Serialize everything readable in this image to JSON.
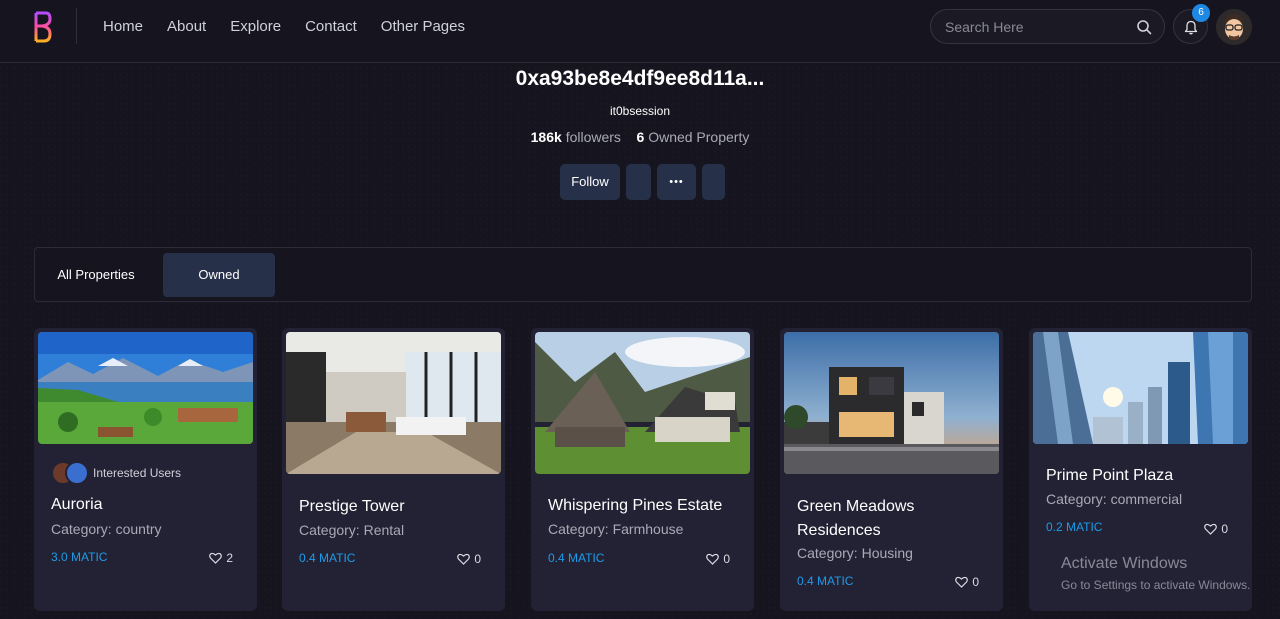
{
  "nav": {
    "links": [
      "Home",
      "About",
      "Explore",
      "Contact",
      "Other Pages"
    ],
    "search_placeholder": "Search Here",
    "notification_count": "6"
  },
  "profile": {
    "name": "0xa93be8e4df9ee8d11a...",
    "handle": "it0bsession",
    "followers_count": "186k",
    "followers_label": "followers",
    "owned_count": "6",
    "owned_label": "Owned Property",
    "follow_label": "Follow",
    "more_label": "•••"
  },
  "tabs": [
    {
      "label": "All Properties",
      "active": false
    },
    {
      "label": "Owned",
      "active": true
    }
  ],
  "cards": [
    {
      "title": "Auroria",
      "category": "Category: country",
      "price": "3.0 MATIC",
      "likes": "2",
      "interested_label": "Interested Users",
      "image": "lake-mountains"
    },
    {
      "title": "Prestige Tower",
      "category": "Category: Rental",
      "price": "0.4 MATIC",
      "likes": "0",
      "image": "office-interior"
    },
    {
      "title": "Whispering Pines Estate",
      "category": "Category: Farmhouse",
      "price": "0.4 MATIC",
      "likes": "0",
      "image": "wooden-barns"
    },
    {
      "title": "Green Meadows Residences",
      "category": "Category: Housing",
      "price": "0.4 MATIC",
      "likes": "0",
      "image": "modern-houses"
    },
    {
      "title": "Prime Point Plaza",
      "category": "Category: commercial",
      "price": "0.2 MATIC",
      "likes": "0",
      "image": "skyscrapers"
    }
  ],
  "watermark": {
    "title": "Activate Windows",
    "subtitle": "Go to Settings to activate Windows."
  },
  "colors": {
    "background": "#16151f",
    "card": "#232234",
    "accent_button": "#263049",
    "price": "#1e9be9",
    "badge": "#1e88e5"
  }
}
